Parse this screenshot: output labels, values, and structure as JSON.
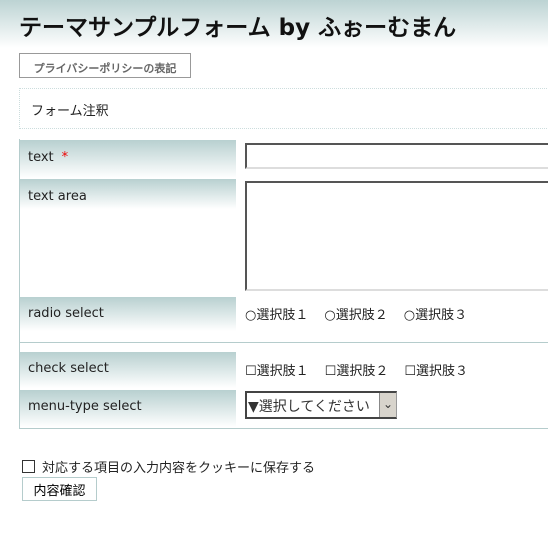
{
  "title": "テーマサンプルフォーム by ふぉーむまん",
  "privacy_button": "プライバシーポリシーの表記",
  "note": "フォーム注釈",
  "fields": {
    "text": {
      "label": "text",
      "required_mark": "*",
      "value": ""
    },
    "textarea": {
      "label": "text area",
      "value": ""
    },
    "radio": {
      "label": "radio select",
      "options": [
        "選択肢１",
        "選択肢２",
        "選択肢３"
      ]
    },
    "check": {
      "label": "check select",
      "options": [
        "選択肢１",
        "選択肢２",
        "選択肢３"
      ]
    },
    "menu": {
      "label": "menu-type select",
      "selected": "▼選択してください"
    }
  },
  "cookie_label": "対応する項目の入力内容をクッキーに保存する",
  "confirm_button": "内容確認"
}
